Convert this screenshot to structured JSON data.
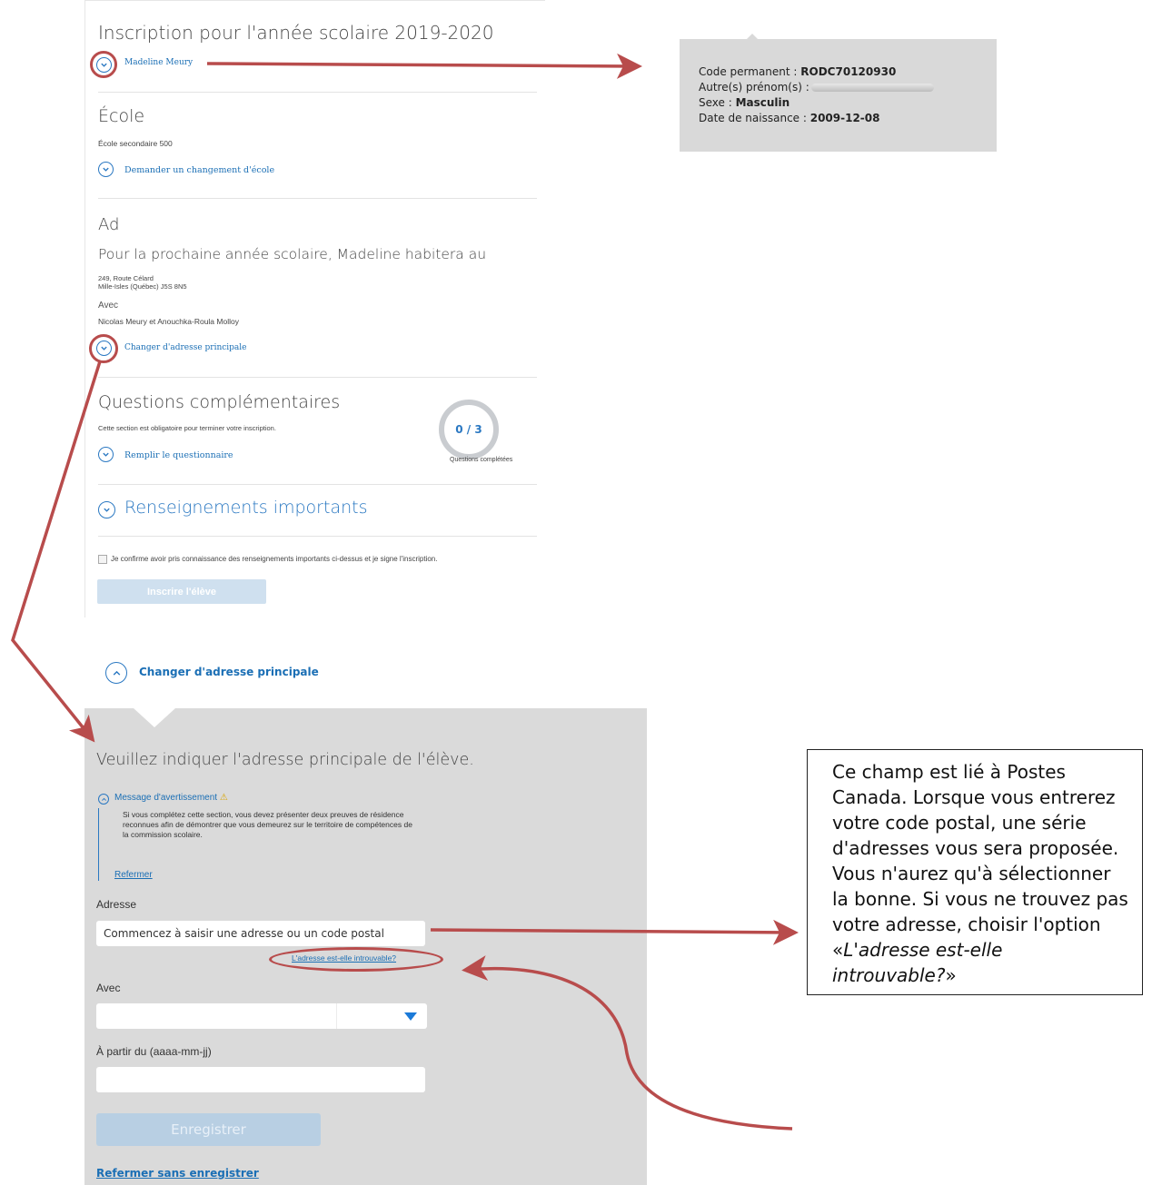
{
  "form": {
    "title": "Inscription pour l'année scolaire 2019-2020",
    "student_name": "Madeline Meury",
    "school_heading": "École",
    "school_name": "École secondaire 500",
    "change_school_link": "Demander un changement d'école",
    "address_heading": "Ad",
    "address_intro": "Pour la prochaine année scolaire, Madeline habitera au",
    "address_line1": "249, Route Célard",
    "address_line2": "Mille-Isles (Québec) J5S 8N5",
    "with_label": "Avec",
    "with_names": "Nicolas Meury et Anouchka-Roula Molloy",
    "change_address_link": "Changer d'adresse principale",
    "questions_heading": "Questions complémentaires",
    "questions_note": "Cette section est obligatoire pour terminer votre inscription.",
    "questions_link": "Remplir le questionnaire",
    "questions_progress": "0 / 3",
    "questions_progress_label": "Questions complétées",
    "important_heading": "Renseignements importants",
    "confirm_text": "Je confirme avoir pris connaissance des renseignements importants ci-dessus et je signe l'inscription.",
    "register_button": "Inscrire l'élève"
  },
  "info": {
    "code_label": "Code permanent : ",
    "code_value": "RODC70120930",
    "other_names_label": "Autre(s) prénom(s) :",
    "sex_label": "Sexe : ",
    "sex_value": "Masculin",
    "birth_label": "Date de naissance : ",
    "birth_value": "2009-12-08"
  },
  "change_address": {
    "toggle_label": "Changer d'adresse principale",
    "prompt": "Veuillez indiquer l'adresse principale de l'élève.",
    "warning_label": "Message d'avertissement",
    "warning_text": "Si vous complétez cette section, vous devez présenter deux preuves de résidence reconnues afin de démontrer que vous demeurez sur le territoire de compétences de la commission scolaire.",
    "close_warning": "Refermer",
    "address_label": "Adresse",
    "address_placeholder": "Commencez à saisir une adresse ou un code postal",
    "not_found_link": "L'adresse est-elle introuvable?",
    "with_label": "Avec",
    "from_label": "À partir du (aaaa-mm-jj)",
    "save_button": "Enregistrer",
    "close_without_save": "Refermer sans enregistrer"
  },
  "callout": {
    "text_before": "Ce champ est lié à Postes Canada. Lorsque vous entrerez votre code postal, une série d'adresses vous sera proposée. Vous n'aurez qu'à sélectionner la bonne. Si vous ne trouvez pas votre adresse, choisir l'option «",
    "text_italic": "L'adresse est-elle introuvable?",
    "text_after": "»"
  },
  "colors": {
    "link_blue": "#1b6fb5",
    "arrow_red": "#b84c4c",
    "panel_grey": "#dadada",
    "disabled_button": "#b8cfe3"
  }
}
